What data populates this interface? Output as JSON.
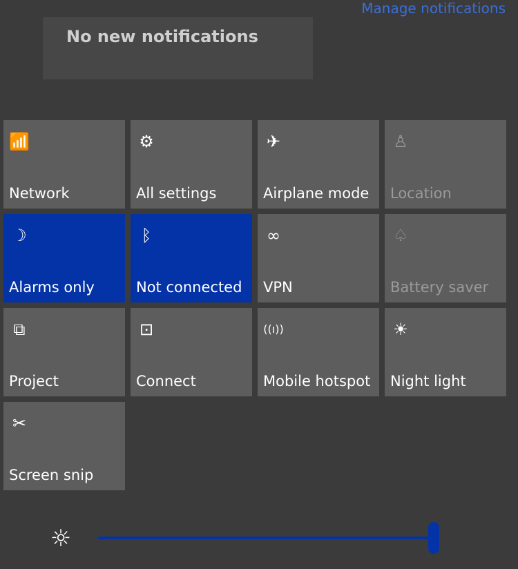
{
  "header": {
    "manage_notifications": "Manage notifications"
  },
  "notifications": {
    "empty_text": "No new notifications"
  },
  "tiles": [
    {
      "label": "Network",
      "icon": "network-icon",
      "glyph": "📶",
      "state": "off"
    },
    {
      "label": "All settings",
      "icon": "gear-icon",
      "glyph": "⚙",
      "state": "off"
    },
    {
      "label": "Airplane mode",
      "icon": "airplane-icon",
      "glyph": "✈",
      "state": "off"
    },
    {
      "label": "Location",
      "icon": "location-icon",
      "glyph": "♙",
      "state": "disabled"
    },
    {
      "label": "Alarms only",
      "icon": "moon-icon",
      "glyph": "☽",
      "state": "on"
    },
    {
      "label": "Not connected",
      "icon": "bluetooth-icon",
      "glyph": "ᛒ",
      "state": "on"
    },
    {
      "label": "VPN",
      "icon": "vpn-icon",
      "glyph": "∞",
      "state": "off"
    },
    {
      "label": "Battery saver",
      "icon": "leaf-icon",
      "glyph": "♤",
      "state": "disabled"
    },
    {
      "label": "Project",
      "icon": "project-icon",
      "glyph": "⧉",
      "state": "off"
    },
    {
      "label": "Connect",
      "icon": "connect-icon",
      "glyph": "⊡",
      "state": "off"
    },
    {
      "label": "Mobile hotspot",
      "icon": "hotspot-icon",
      "glyph": "((ı))",
      "state": "off"
    },
    {
      "label": "Night light",
      "icon": "night-light-icon",
      "glyph": "☀",
      "state": "off"
    },
    {
      "label": "Screen snip",
      "icon": "screen-snip-icon",
      "glyph": "✂",
      "state": "off"
    }
  ],
  "brightness": {
    "icon": "brightness-icon",
    "glyph": "☼",
    "value_percent": 100,
    "accent": "#0433a8"
  }
}
